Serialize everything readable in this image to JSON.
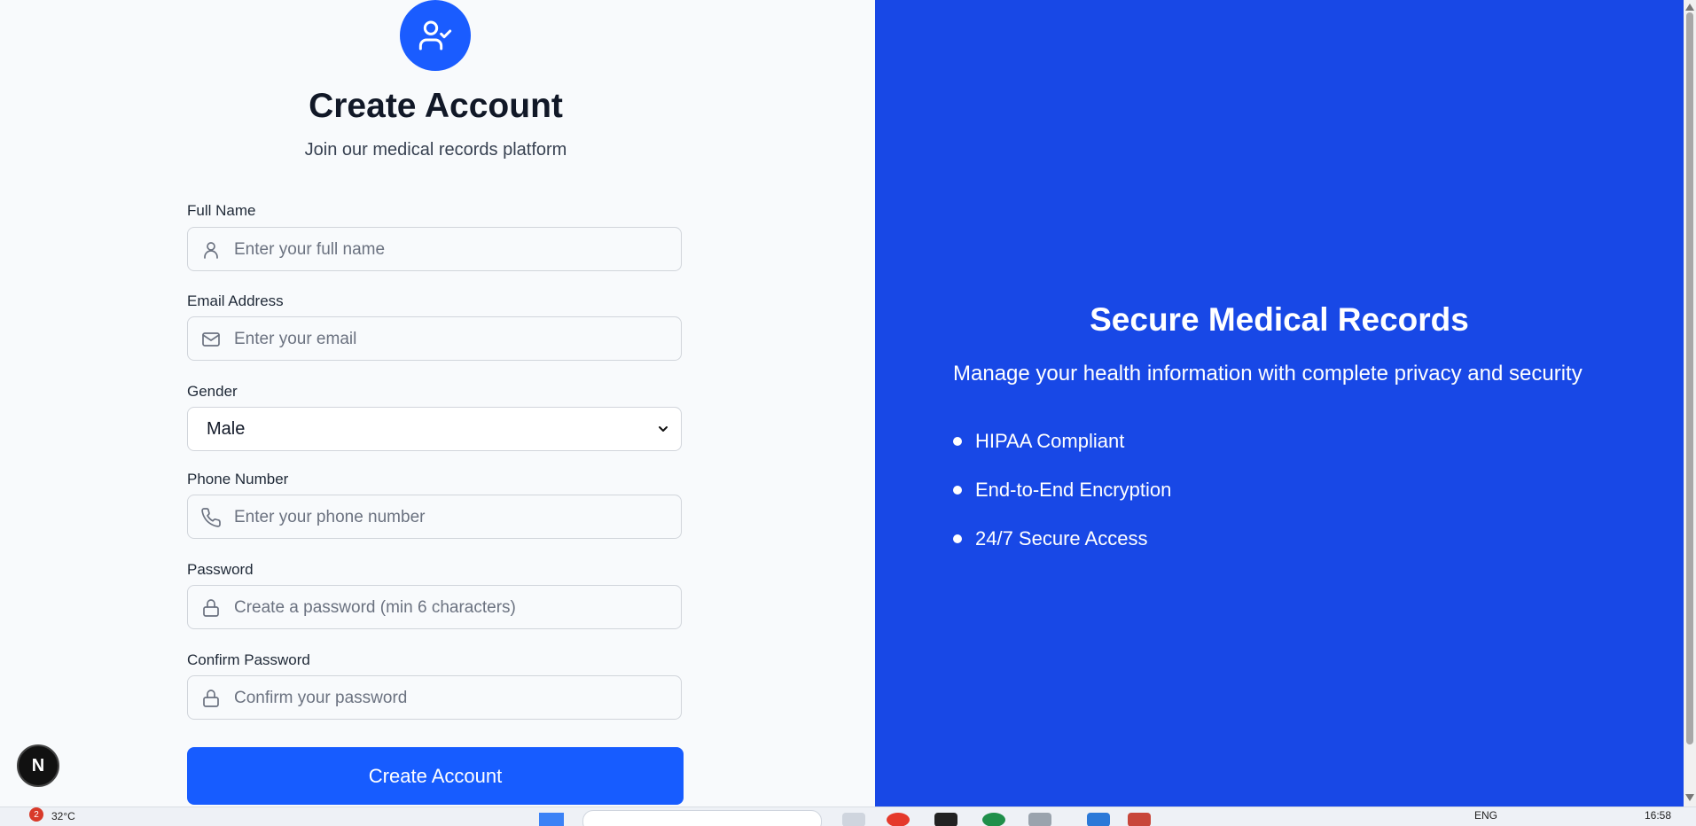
{
  "header": {
    "icon": "user-check-icon",
    "title": "Create Account",
    "subtitle": "Join our medical records platform"
  },
  "form": {
    "full_name": {
      "label": "Full Name",
      "placeholder": "Enter your full name",
      "icon": "user-icon"
    },
    "email": {
      "label": "Email Address",
      "placeholder": "Enter your email",
      "icon": "mail-icon"
    },
    "gender": {
      "label": "Gender",
      "value": "Male"
    },
    "phone": {
      "label": "Phone Number",
      "placeholder": "Enter your phone number",
      "icon": "phone-icon"
    },
    "password": {
      "label": "Password",
      "placeholder": "Create a password (min 6 characters)",
      "icon": "lock-icon"
    },
    "confirm_password": {
      "label": "Confirm Password",
      "placeholder": "Confirm your password",
      "icon": "lock-icon"
    },
    "submit_label": "Create Account"
  },
  "promo": {
    "title": "Secure Medical Records",
    "text": "Manage your health information with complete privacy and security",
    "features": [
      "HIPAA Compliant",
      "End-to-End Encryption",
      "24/7 Secure Access"
    ]
  },
  "dev_badge": {
    "label": "N"
  },
  "taskbar": {
    "weather_badge": "2",
    "temperature": "32°C",
    "language": "ENG",
    "time": "16:58"
  },
  "colors": {
    "primary": "#175cff",
    "panel_blue": "#1848e6",
    "page_bg": "#f8fafc"
  }
}
